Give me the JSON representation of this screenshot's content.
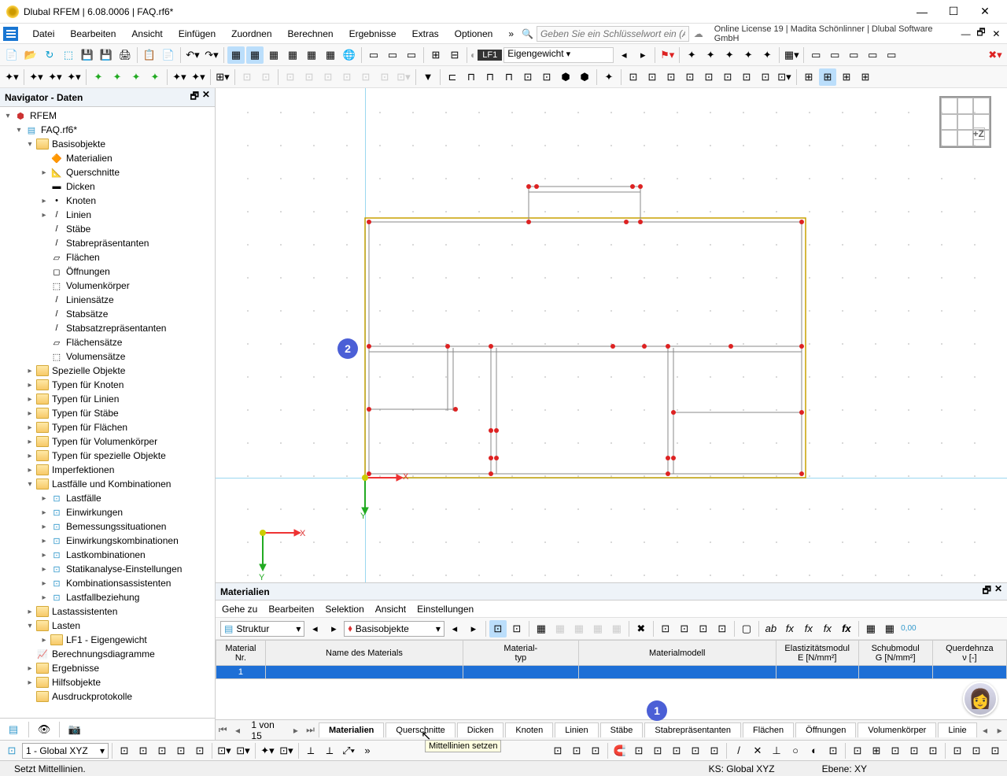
{
  "titlebar": {
    "title": "Dlubal RFEM | 6.08.0006 | FAQ.rf6*"
  },
  "menubar": {
    "items": [
      "Datei",
      "Bearbeiten",
      "Ansicht",
      "Einfügen",
      "Zuordnen",
      "Berechnen",
      "Ergebnisse",
      "Extras",
      "Optionen"
    ],
    "overflow": "»",
    "search_placeholder": "Geben Sie ein Schlüsselwort ein (Alt...",
    "license": "Online License 19 | Madita Schönlinner | Dlubal Software GmbH"
  },
  "loadcase": {
    "code": "LF1",
    "name": "Eigengewicht"
  },
  "navigator": {
    "title": "Navigator - Daten",
    "root": "RFEM",
    "file": "FAQ.rf6*",
    "basis_label": "Basisobjekte",
    "basis_children": [
      "Materialien",
      "Querschnitte",
      "Dicken",
      "Knoten",
      "Linien",
      "Stäbe",
      "Stabrepräsentanten",
      "Flächen",
      "Öffnungen",
      "Volumenkörper",
      "Liniensätze",
      "Stabsätze",
      "Stabsatzrepräsentanten",
      "Flächensätze",
      "Volumensätze"
    ],
    "folders1": [
      "Spezielle Objekte",
      "Typen für Knoten",
      "Typen für Linien",
      "Typen für Stäbe",
      "Typen für Flächen",
      "Typen für Volumenkörper",
      "Typen für spezielle Objekte",
      "Imperfektionen"
    ],
    "lastfaelle_label": "Lastfälle und Kombinationen",
    "lastfaelle_children": [
      "Lastfälle",
      "Einwirkungen",
      "Bemessungssituationen",
      "Einwirkungskombinationen",
      "Lastkombinationen",
      "Statikanalyse-Einstellungen",
      "Kombinationsassistenten",
      "Lastfallbeziehung"
    ],
    "after_lf": [
      "Lastassistenten"
    ],
    "lasten_label": "Lasten",
    "lasten_children": [
      "LF1 - Eigengewicht"
    ],
    "folders2": [
      "Berechnungsdiagramme",
      "Ergebnisse",
      "Hilfsobjekte",
      "Ausdruckprotokolle"
    ]
  },
  "viewcube": {
    "label": "+Z"
  },
  "callouts": {
    "c1": "1",
    "c2": "2"
  },
  "axes": {
    "x": "X",
    "y": "Y"
  },
  "bottom_panel": {
    "title": "Materialien",
    "menu": [
      "Gehe zu",
      "Bearbeiten",
      "Selektion",
      "Ansicht",
      "Einstellungen"
    ],
    "sel1": "Struktur",
    "sel2": "Basisobjekte",
    "columns": [
      "Material\nNr.",
      "Name des Materials",
      "Material-\ntyp",
      "Materialmodell",
      "Elastizitätsmodul\nE [N/mm²]",
      "Schubmodul\nG [N/mm²]",
      "Querdehnza\nν [-]"
    ],
    "row1_no": "1",
    "pager": "1 von 15",
    "tabs": [
      "Materialien",
      "Querschnitte",
      "Dicken",
      "Knoten",
      "Linien",
      "Stäbe",
      "Stabrepräsentanten",
      "Flächen",
      "Öffnungen",
      "Volumenkörper",
      "Linie"
    ]
  },
  "bottombar": {
    "cs": "1 - Global XYZ"
  },
  "statusbar": {
    "hint": "Setzt Mittellinien.",
    "ks": "KS: Global XYZ",
    "ebene": "Ebene: XY"
  },
  "tooltip": "Mittellinien setzen"
}
